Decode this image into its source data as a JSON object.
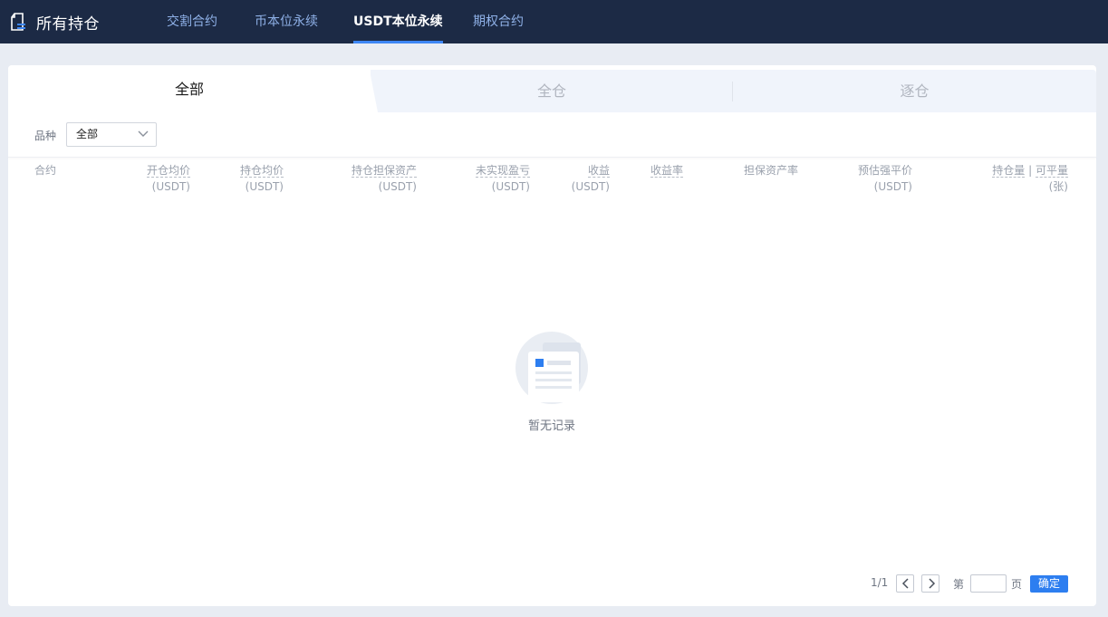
{
  "header": {
    "title": "所有持仓",
    "brand_icon": "positions-document-icon",
    "nav": [
      {
        "label": "交割合约",
        "active": false
      },
      {
        "label": "币本位永续",
        "active": false
      },
      {
        "label": "USDT本位永续",
        "active": true
      },
      {
        "label": "期权合约",
        "active": false
      }
    ]
  },
  "tabs": [
    {
      "label": "全部",
      "active": true
    },
    {
      "label": "全仓",
      "active": false
    },
    {
      "label": "逐仓",
      "active": false
    }
  ],
  "filter": {
    "label": "品种",
    "selected": "全部"
  },
  "table": {
    "columns": [
      {
        "label": "合约",
        "unit": ""
      },
      {
        "label": "开仓均价",
        "unit": "(USDT)"
      },
      {
        "label": "持仓均价",
        "unit": "(USDT)"
      },
      {
        "label": "持仓担保资产",
        "unit": "(USDT)"
      },
      {
        "label": "未实现盈亏",
        "unit": "(USDT)"
      },
      {
        "label": "收益",
        "unit": "(USDT)"
      },
      {
        "label": "收益率",
        "unit": ""
      },
      {
        "label": "担保资产率",
        "unit": ""
      },
      {
        "label": "预估强平价",
        "unit": "(USDT)"
      },
      {
        "label": "持仓量 | 可平量",
        "label_a": "持仓量",
        "label_sep": " | ",
        "label_b": "可平量",
        "unit": "(张)"
      }
    ],
    "rows": []
  },
  "empty_state": {
    "text": "暂无记录",
    "icon": "empty-document-icon"
  },
  "pagination": {
    "count": "1/1",
    "page_prefix": "第",
    "page_suffix": "页",
    "page_value": "",
    "confirm_label": "确定"
  },
  "colors": {
    "topbar": "#1c2a45",
    "nav_active_underline": "#3d86f4",
    "nav_inactive": "#8fb1e8",
    "primary_button": "#2d7ef0",
    "page_background": "#e8ecf3"
  }
}
